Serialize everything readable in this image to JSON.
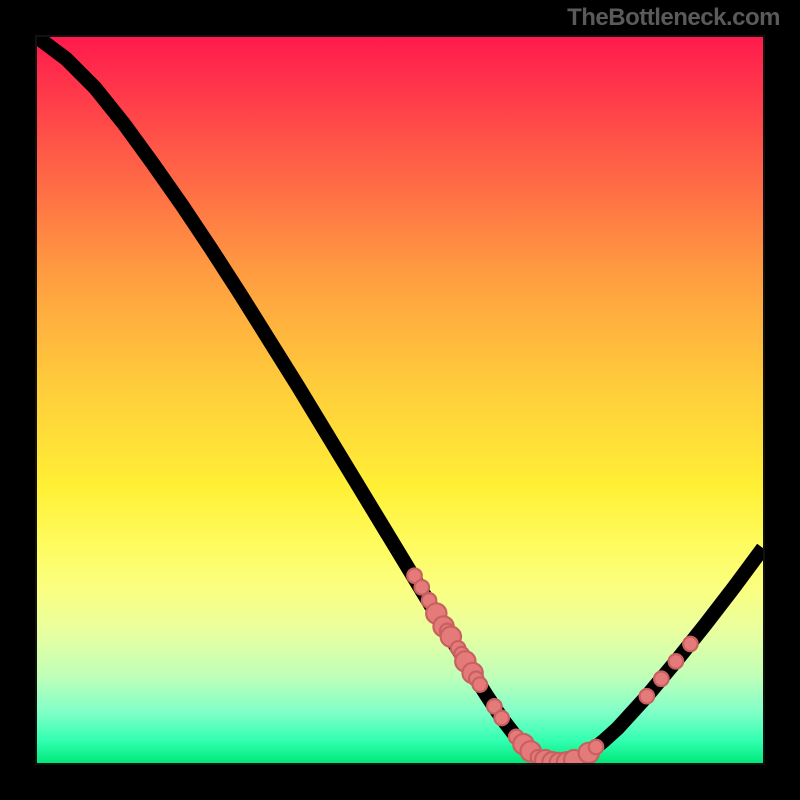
{
  "watermark": "TheBottleneck.com",
  "chart_data": {
    "type": "line",
    "title": "",
    "xlabel": "",
    "ylabel": "",
    "xlim": [
      0,
      100
    ],
    "ylim": [
      0,
      100
    ],
    "grid": false,
    "legend": false,
    "background_gradient": [
      "#ff1a4d",
      "#ff9a41",
      "#fff035",
      "#00e878"
    ],
    "series": [
      {
        "name": "bottleneck-curve",
        "color": "#000000",
        "x": [
          0,
          4,
          8,
          12,
          16,
          20,
          24,
          28,
          32,
          36,
          40,
          44,
          48,
          52,
          56,
          60,
          62,
          64,
          66,
          68,
          70,
          72,
          74,
          76,
          78,
          80,
          84,
          88,
          92,
          96,
          100
        ],
        "y": [
          100,
          97,
          93,
          88,
          82.5,
          76.8,
          70.8,
          64.6,
          58.2,
          51.8,
          45.2,
          38.6,
          32,
          25.4,
          18.8,
          12.4,
          9.2,
          6.2,
          3.6,
          1.6,
          0.4,
          0,
          0.4,
          1.4,
          3,
          4.8,
          9.2,
          14,
          19,
          24.2,
          29.6
        ]
      }
    ],
    "scatter_points": {
      "name": "highlighted-points",
      "color": "#e47a7a",
      "points": [
        {
          "x": 52,
          "y": 25.8,
          "r": 1.0
        },
        {
          "x": 53,
          "y": 24.2,
          "r": 1.0
        },
        {
          "x": 54,
          "y": 22.4,
          "r": 1.0
        },
        {
          "x": 55,
          "y": 20.6,
          "r": 1.4
        },
        {
          "x": 56,
          "y": 18.8,
          "r": 1.4
        },
        {
          "x": 56.5,
          "y": 18.2,
          "r": 1.0
        },
        {
          "x": 57,
          "y": 17.4,
          "r": 1.4
        },
        {
          "x": 58,
          "y": 15.8,
          "r": 1.0
        },
        {
          "x": 58.5,
          "y": 15.0,
          "r": 1.0
        },
        {
          "x": 59,
          "y": 14.0,
          "r": 1.4
        },
        {
          "x": 60,
          "y": 12.4,
          "r": 1.4
        },
        {
          "x": 60.5,
          "y": 11.6,
          "r": 1.0
        },
        {
          "x": 61,
          "y": 10.8,
          "r": 1.0
        },
        {
          "x": 63,
          "y": 7.8,
          "r": 1.0
        },
        {
          "x": 64,
          "y": 6.2,
          "r": 1.0
        },
        {
          "x": 66,
          "y": 3.6,
          "r": 1.0
        },
        {
          "x": 67,
          "y": 2.6,
          "r": 1.4
        },
        {
          "x": 68,
          "y": 1.6,
          "r": 1.4
        },
        {
          "x": 69,
          "y": 0.8,
          "r": 1.0
        },
        {
          "x": 70,
          "y": 0.4,
          "r": 1.4
        },
        {
          "x": 71,
          "y": 0.1,
          "r": 1.4
        },
        {
          "x": 72,
          "y": 0.0,
          "r": 1.4
        },
        {
          "x": 73,
          "y": 0.1,
          "r": 1.4
        },
        {
          "x": 74,
          "y": 0.4,
          "r": 1.4
        },
        {
          "x": 76,
          "y": 1.4,
          "r": 1.4
        },
        {
          "x": 77,
          "y": 2.2,
          "r": 1.0
        },
        {
          "x": 84,
          "y": 9.2,
          "r": 1.0
        },
        {
          "x": 86,
          "y": 11.6,
          "r": 1.0
        },
        {
          "x": 88,
          "y": 14.0,
          "r": 1.0
        },
        {
          "x": 90,
          "y": 16.4,
          "r": 1.0
        }
      ]
    }
  }
}
